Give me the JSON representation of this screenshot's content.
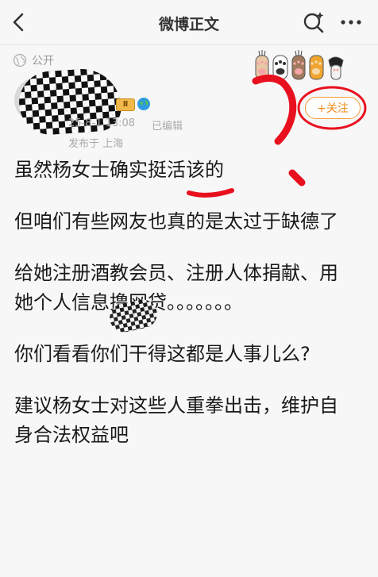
{
  "nav": {
    "title": "微博正文"
  },
  "post_meta": {
    "visibility": "公开",
    "vip_badge": "Ⅱ",
    "time": "25-8-1 13:08",
    "edited": "已编辑",
    "location": "发布于 上海",
    "follow_label": "+关注"
  },
  "post": {
    "paragraphs": [
      "虽然杨女士确实挺活该的",
      "但咱们有些网友也真的是太过于缺德了",
      "给她注册酒教会员、注册人体捐献、用她个人信息撸网贷。。。。。。。",
      "你们看看你们干得这都是人事儿么?",
      "建议杨女士对这些人重拳出击，维护自身合法权益吧"
    ]
  },
  "icons": {
    "back": "chevron-left-icon",
    "search": "search-sparkle-icon",
    "more": "more-dots-icon",
    "visibility": "globe-icon",
    "paws": "cat-paw-stickers-icon",
    "badge_globe": "earth-badge-icon"
  },
  "colors": {
    "accent": "#f08a1c",
    "annotation": "#e8101e",
    "background": "#f7f7f7"
  }
}
